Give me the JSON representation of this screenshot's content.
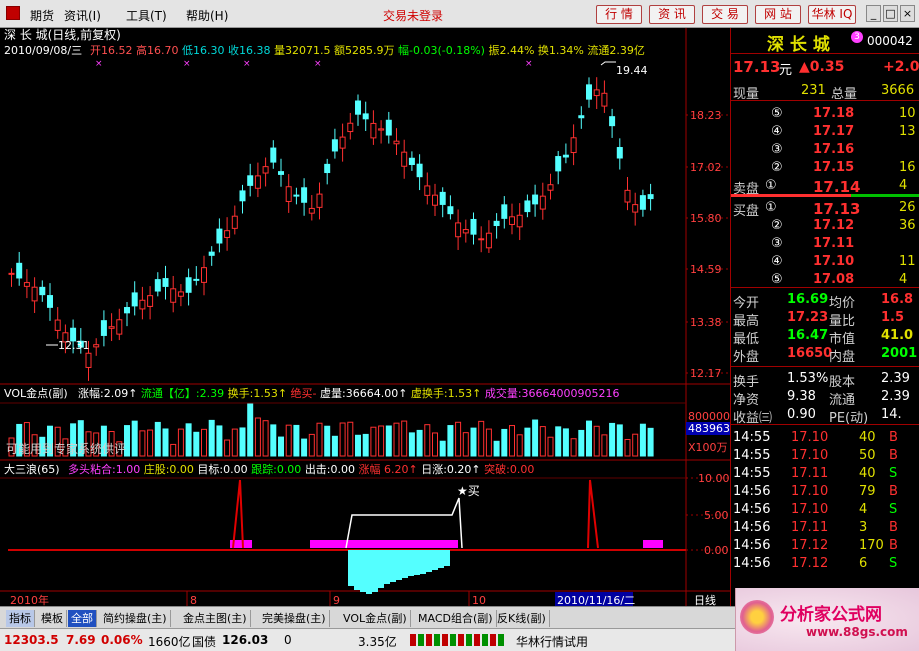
{
  "menubar": {
    "items": [
      "期货",
      "资讯(I)",
      "工具(T)",
      "帮助(H)"
    ],
    "login_status": "交易未登录",
    "buttons": [
      "行 情",
      "资 讯",
      "交 易",
      "网 站",
      "华林 IQ"
    ]
  },
  "chart": {
    "title": "深 长 城(日线,前复权)",
    "info_date": "2010/09/08/三",
    "info_fields": [
      {
        "label": "开",
        "value": "16.52",
        "color": "#ff5050"
      },
      {
        "label": "高",
        "value": "16.70",
        "color": "#ff5050"
      },
      {
        "label": "低",
        "value": "16.30",
        "color": "#00d8d8"
      },
      {
        "label": "收",
        "value": "16.38",
        "color": "#00d8d8"
      },
      {
        "label": "量",
        "value": "32071.5",
        "color": "#e0e000"
      },
      {
        "label": "额",
        "value": "5285.9万",
        "color": "#e0e000"
      },
      {
        "label": "幅",
        "value": "-0.03(-0.18%)",
        "color": "#00ff00"
      },
      {
        "label": "振",
        "value": "2.44%",
        "color": "#e0e000"
      },
      {
        "label": "换",
        "value": "1.34%",
        "color": "#e0e000"
      },
      {
        "label": "流通",
        "value": "2.39亿",
        "color": "#e0e000"
      }
    ],
    "y_ticks": [
      "18.23",
      "17.02",
      "15.80",
      "14.59",
      "13.38",
      "12.17"
    ],
    "high_label": "19.44",
    "low_label": "12.31",
    "vol_title": "VOL金点(副)",
    "vol_fields": [
      {
        "text": "涨幅:2.09↑",
        "color": "#ffffff"
      },
      {
        "text": "流通【亿】:2.39",
        "color": "#00ff00"
      },
      {
        "text": "换手:1.53↑",
        "color": "#e0e000"
      },
      {
        "text": "绝买-",
        "color": "#ff3030"
      },
      {
        "text": "虚量:36664.00↑",
        "color": "#ffffff"
      },
      {
        "text": "虚换手:1.53↑",
        "color": "#e0e000"
      },
      {
        "text": "成交量:36664000905216",
        "color": "#ff40ff"
      }
    ],
    "vol_note": "可能用到专家系统供评",
    "vol_ticks": {
      "v800": "800000",
      "v483": "483963",
      "unit": "X100万"
    },
    "ind_title": "大三浪(65)",
    "ind_fields": [
      {
        "text": "多头粘合:1.00",
        "color": "#ff40ff"
      },
      {
        "text": "庄股:0.00",
        "color": "#e0e000"
      },
      {
        "text": "目标:0.00",
        "color": "#ffffff"
      },
      {
        "text": "跟踪:0.00",
        "color": "#00ff00"
      },
      {
        "text": "出击:0.00",
        "color": "#ffffff"
      },
      {
        "text": "涨幅 6.20↑",
        "color": "#ff3030"
      },
      {
        "text": "日涨:0.20↑",
        "color": "#ffffff"
      },
      {
        "text": "突破:0.00",
        "color": "#ff3030"
      }
    ],
    "ind_ticks": [
      "10.00",
      "5.00",
      "0.00"
    ],
    "buy_label": "★买",
    "x_labels": [
      "2010年",
      "8",
      "9",
      "10"
    ],
    "cursor_date": "2010/11/16/二",
    "period": "日线"
  },
  "right": {
    "stock_name": "深 长 城",
    "stock_code": "000042",
    "price": "17.13",
    "price_unit": "元",
    "change": "▲0.35",
    "change2": "+2.0",
    "cur_vol_label": "现量",
    "cur_vol": "231",
    "total_vol_label": "总量",
    "total_vol": "3666",
    "sell": [
      {
        "idx": "⑤",
        "price": "17.18",
        "vol": "10"
      },
      {
        "idx": "④",
        "price": "17.17",
        "vol": "13"
      },
      {
        "idx": "③",
        "price": "17.16",
        "vol": ""
      },
      {
        "idx": "②",
        "price": "17.15",
        "vol": "16"
      },
      {
        "idx": "①",
        "price": "17.14",
        "vol": "4"
      }
    ],
    "sell_label": "卖盘",
    "buy_label": "买盘",
    "buy": [
      {
        "idx": "①",
        "price": "17.13",
        "vol": "26"
      },
      {
        "idx": "②",
        "price": "17.12",
        "vol": "36"
      },
      {
        "idx": "③",
        "price": "17.11",
        "vol": ""
      },
      {
        "idx": "④",
        "price": "17.10",
        "vol": "11"
      },
      {
        "idx": "⑤",
        "price": "17.08",
        "vol": "4"
      }
    ],
    "stats": [
      {
        "l1": "今开",
        "v1": "16.69",
        "c1": "#00ff00",
        "l2": "均价",
        "v2": "16.8",
        "c2": "#ff3030"
      },
      {
        "l1": "最高",
        "v1": "17.23",
        "c1": "#ff3030",
        "l2": "量比",
        "v2": "1.5",
        "c2": "#ff3030"
      },
      {
        "l1": "最低",
        "v1": "16.47",
        "c1": "#00ff00",
        "l2": "市值",
        "v2": "41.0",
        "c2": "#e0e000"
      },
      {
        "l1": "外盘",
        "v1": "16650",
        "c1": "#ff3030",
        "l2": "内盘",
        "v2": "2001",
        "c2": "#00ff00"
      }
    ],
    "stats2": [
      {
        "l1": "换手",
        "v1": "1.53%",
        "l2": "股本",
        "v2": "2.39"
      },
      {
        "l1": "净资",
        "v1": "9.38",
        "l2": "流通",
        "v2": "2.39"
      },
      {
        "l1": "收益㈢",
        "v1": "0.90",
        "l2": "PE(动)",
        "v2": "14."
      }
    ],
    "ticks": [
      {
        "time": "14:55",
        "price": "17.10",
        "vol": "40",
        "dir": "B"
      },
      {
        "time": "14:55",
        "price": "17.10",
        "vol": "50",
        "dir": "B"
      },
      {
        "time": "14:55",
        "price": "17.11",
        "vol": "40",
        "dir": "S"
      },
      {
        "time": "14:56",
        "price": "17.10",
        "vol": "79",
        "dir": "B"
      },
      {
        "time": "14:56",
        "price": "17.10",
        "vol": "4",
        "dir": "S"
      },
      {
        "time": "14:56",
        "price": "17.11",
        "vol": "3",
        "dir": "B"
      },
      {
        "time": "14:56",
        "price": "17.12",
        "vol": "170",
        "dir": "B"
      },
      {
        "time": "14:56",
        "price": "17.12",
        "vol": "6",
        "dir": "S"
      }
    ]
  },
  "tabs": [
    "指标",
    "模板",
    "全部",
    "简约操盘(主)",
    "金点主图(主)",
    "完美操盘(主)",
    "VOL金点(副)",
    "MACD组合(副)",
    "反K线(副)"
  ],
  "status": {
    "index": "12303.5",
    "chg": "7.69",
    "pct": "0.06%",
    "amount": "1660亿",
    "bond_label": "国债",
    "bond": "126.03",
    "bond_chg": "0",
    "bond_amt": "3.35亿",
    "feed": "华林行情试用"
  },
  "watermark": {
    "title": "分析家公式网",
    "url": "www.88gs.com"
  }
}
